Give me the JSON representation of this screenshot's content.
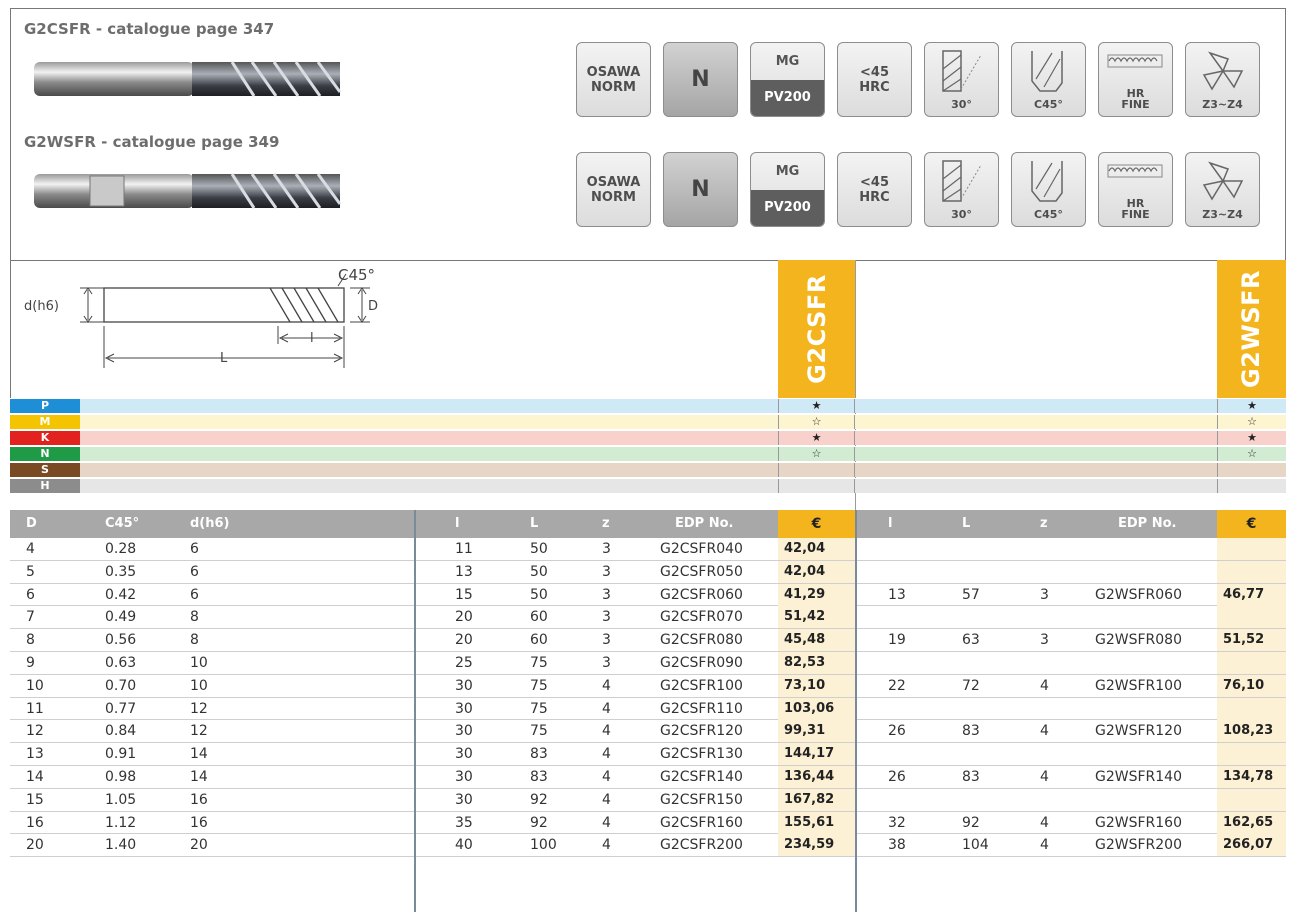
{
  "products": [
    {
      "title": "G2CSFR - catalogue page 347",
      "code": "G2CSFR"
    },
    {
      "title": "G2WSFR - catalogue page 349",
      "code": "G2WSFR"
    }
  ],
  "icons": {
    "osawa": [
      "OSAWA",
      "NORM"
    ],
    "n": "N",
    "mg_top": "MG",
    "mg_bottom": "PV200",
    "hrc": [
      "<45",
      "HRC"
    ],
    "helix": "30°",
    "chamfer": "C45°",
    "hr": [
      "HR",
      "FINE"
    ],
    "flutes": "Z3~Z4"
  },
  "diagram": {
    "c45": "C45°",
    "dh6": "d(h6)",
    "D": "D",
    "l": "l",
    "L": "L"
  },
  "materials": [
    {
      "tag": "P",
      "color": "#1e8fd6",
      "bg": "#cfe9f7",
      "g2c": "★",
      "g2w": "★"
    },
    {
      "tag": "M",
      "color": "#f5c400",
      "bg": "#fcf5cf",
      "g2c": "☆",
      "g2w": "☆"
    },
    {
      "tag": "K",
      "color": "#e2221f",
      "bg": "#f8d0cc",
      "g2c": "★",
      "g2w": "★"
    },
    {
      "tag": "N",
      "color": "#1f9b48",
      "bg": "#d2ecd3",
      "g2c": "☆",
      "g2w": "☆"
    },
    {
      "tag": "S",
      "color": "#7a4a22",
      "bg": "#e7d5c5",
      "g2c": "",
      "g2w": ""
    },
    {
      "tag": "H",
      "color": "#8c8c8c",
      "bg": "#e6e6e6",
      "g2c": "",
      "g2w": ""
    }
  ],
  "headers": {
    "D": "D",
    "c45": "C45°",
    "dh6": "d(h6)",
    "l": "l",
    "L": "L",
    "z": "z",
    "edp": "EDP No.",
    "euro": "€",
    "l2": "l",
    "L2": "L",
    "z2": "z",
    "edp2": "EDP No.",
    "euro2": "€"
  },
  "rows": [
    {
      "D": "4",
      "c": "0.28",
      "d": "6",
      "l": "11",
      "L": "50",
      "z": "3",
      "edp": "G2CSFR040",
      "p": "42,04",
      "l2": "",
      "L2": "",
      "z2": "",
      "edp2": "",
      "p2": ""
    },
    {
      "D": "5",
      "c": "0.35",
      "d": "6",
      "l": "13",
      "L": "50",
      "z": "3",
      "edp": "G2CSFR050",
      "p": "42,04",
      "l2": "",
      "L2": "",
      "z2": "",
      "edp2": "",
      "p2": ""
    },
    {
      "D": "6",
      "c": "0.42",
      "d": "6",
      "l": "15",
      "L": "50",
      "z": "3",
      "edp": "G2CSFR060",
      "p": "41,29",
      "l2": "13",
      "L2": "57",
      "z2": "3",
      "edp2": "G2WSFR060",
      "p2": "46,77"
    },
    {
      "D": "7",
      "c": "0.49",
      "d": "8",
      "l": "20",
      "L": "60",
      "z": "3",
      "edp": "G2CSFR070",
      "p": "51,42",
      "l2": "",
      "L2": "",
      "z2": "",
      "edp2": "",
      "p2": ""
    },
    {
      "D": "8",
      "c": "0.56",
      "d": "8",
      "l": "20",
      "L": "60",
      "z": "3",
      "edp": "G2CSFR080",
      "p": "45,48",
      "l2": "19",
      "L2": "63",
      "z2": "3",
      "edp2": "G2WSFR080",
      "p2": "51,52"
    },
    {
      "D": "9",
      "c": "0.63",
      "d": "10",
      "l": "25",
      "L": "75",
      "z": "3",
      "edp": "G2CSFR090",
      "p": "82,53",
      "l2": "",
      "L2": "",
      "z2": "",
      "edp2": "",
      "p2": ""
    },
    {
      "D": "10",
      "c": "0.70",
      "d": "10",
      "l": "30",
      "L": "75",
      "z": "4",
      "edp": "G2CSFR100",
      "p": "73,10",
      "l2": "22",
      "L2": "72",
      "z2": "4",
      "edp2": "G2WSFR100",
      "p2": "76,10"
    },
    {
      "D": "11",
      "c": "0.77",
      "d": "12",
      "l": "30",
      "L": "75",
      "z": "4",
      "edp": "G2CSFR110",
      "p": "103,06",
      "l2": "",
      "L2": "",
      "z2": "",
      "edp2": "",
      "p2": ""
    },
    {
      "D": "12",
      "c": "0.84",
      "d": "12",
      "l": "30",
      "L": "75",
      "z": "4",
      "edp": "G2CSFR120",
      "p": "99,31",
      "l2": "26",
      "L2": "83",
      "z2": "4",
      "edp2": "G2WSFR120",
      "p2": "108,23"
    },
    {
      "D": "13",
      "c": "0.91",
      "d": "14",
      "l": "30",
      "L": "83",
      "z": "4",
      "edp": "G2CSFR130",
      "p": "144,17",
      "l2": "",
      "L2": "",
      "z2": "",
      "edp2": "",
      "p2": ""
    },
    {
      "D": "14",
      "c": "0.98",
      "d": "14",
      "l": "30",
      "L": "83",
      "z": "4",
      "edp": "G2CSFR140",
      "p": "136,44",
      "l2": "26",
      "L2": "83",
      "z2": "4",
      "edp2": "G2WSFR140",
      "p2": "134,78"
    },
    {
      "D": "15",
      "c": "1.05",
      "d": "16",
      "l": "30",
      "L": "92",
      "z": "4",
      "edp": "G2CSFR150",
      "p": "167,82",
      "l2": "",
      "L2": "",
      "z2": "",
      "edp2": "",
      "p2": ""
    },
    {
      "D": "16",
      "c": "1.12",
      "d": "16",
      "l": "35",
      "L": "92",
      "z": "4",
      "edp": "G2CSFR160",
      "p": "155,61",
      "l2": "32",
      "L2": "92",
      "z2": "4",
      "edp2": "G2WSFR160",
      "p2": "162,65"
    },
    {
      "D": "20",
      "c": "1.40",
      "d": "20",
      "l": "40",
      "L": "100",
      "z": "4",
      "edp": "G2CSFR200",
      "p": "234,59",
      "l2": "38",
      "L2": "104",
      "z2": "4",
      "edp2": "G2WSFR200",
      "p2": "266,07"
    }
  ]
}
